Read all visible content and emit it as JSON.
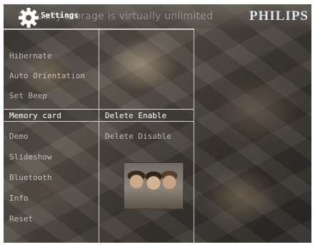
{
  "header": {
    "banner_text": "Virtually storage is virtually unlimited",
    "title": "Settings",
    "logo": "PHILIPS",
    "settings_icon": "gear-icon"
  },
  "menu": {
    "items": [
      {
        "label": "Hibernate"
      },
      {
        "label": "Auto Orientation"
      },
      {
        "label": "Set Beep"
      },
      {
        "label": "Memory card"
      },
      {
        "label": "Demo"
      },
      {
        "label": "Slideshow"
      },
      {
        "label": "Bluetooth"
      },
      {
        "label": "Info"
      },
      {
        "label": "Reset"
      }
    ],
    "selected": "Memory card"
  },
  "submenu": {
    "items": [
      {
        "label": "Delete Enable"
      },
      {
        "label": "Delete Disable"
      }
    ],
    "selected": "Delete Enable"
  },
  "colors": {
    "text_selected": "#ffffff",
    "text_normal": "#c8c8c8",
    "divider": "#e1e1e1",
    "logo": "#dde3ee"
  }
}
